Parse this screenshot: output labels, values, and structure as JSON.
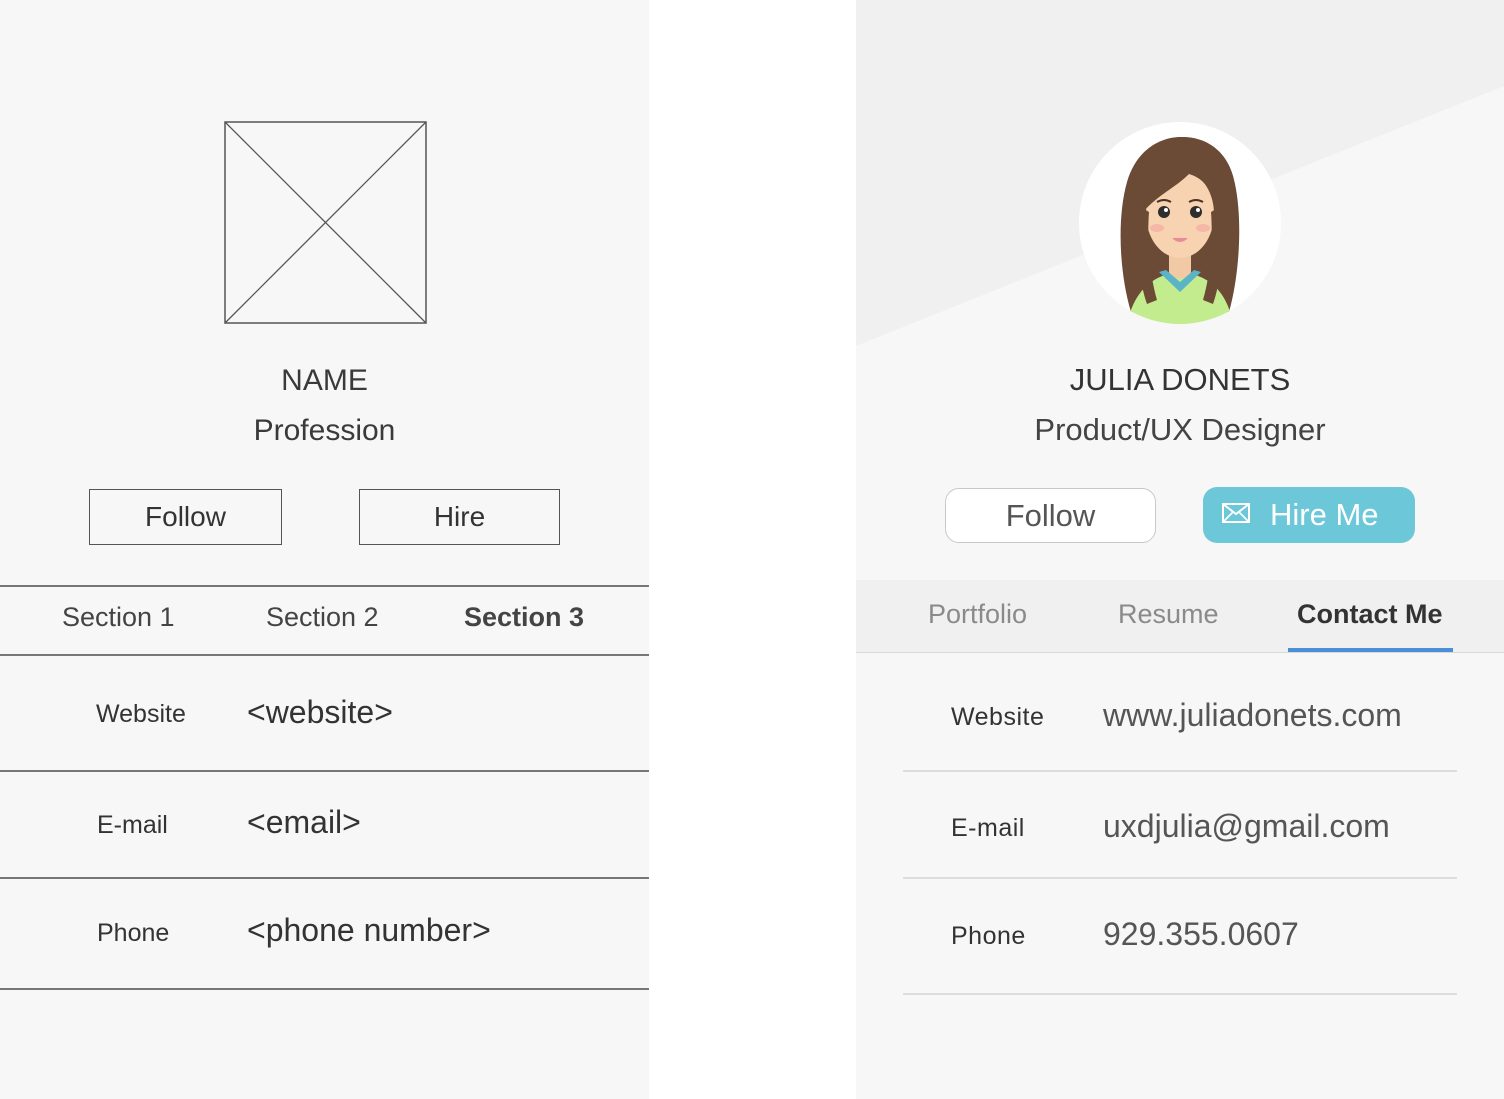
{
  "wireframe": {
    "name": "NAME",
    "profession": "Profession",
    "follow_label": "Follow",
    "hire_label": "Hire",
    "tabs": [
      "Section 1",
      "Section 2",
      "Section 3"
    ],
    "active_tab": "Section 3",
    "rows": [
      {
        "label": "Website",
        "value": "<website>"
      },
      {
        "label": "E-mail",
        "value": "<email>"
      },
      {
        "label": "Phone",
        "value": "<phone number>"
      }
    ],
    "image_icon": "image-placeholder-icon"
  },
  "design": {
    "name": "JULIA DONETS",
    "profession": "Product/UX Designer",
    "follow_label": "Follow",
    "hire_label": "Hire Me",
    "hire_icon": "mail-icon",
    "tabs": [
      "Portfolio",
      "Resume",
      "Contact Me"
    ],
    "active_tab": "Contact Me",
    "rows": [
      {
        "label": "Website",
        "value": "www.juliadonets.com"
      },
      {
        "label": "E-mail",
        "value": "uxdjulia@gmail.com"
      },
      {
        "label": "Phone",
        "value": "929.355.0607"
      }
    ],
    "colors": {
      "accent": "#6cc8d9",
      "tab_indicator": "#4a90d9",
      "background": "#f7f7f7",
      "header_band": "#f0f0f0"
    }
  }
}
